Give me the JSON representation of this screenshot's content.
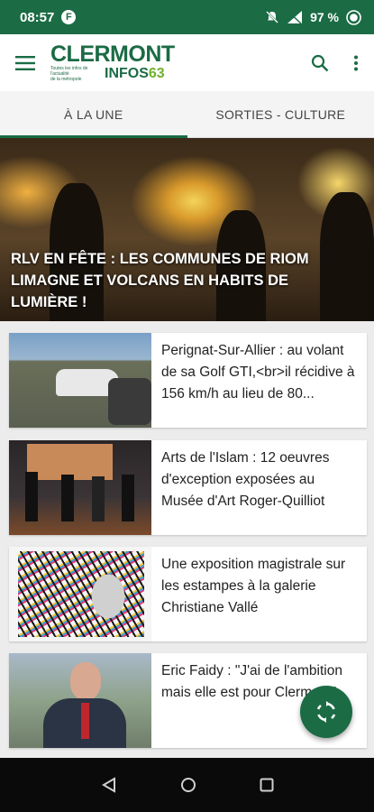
{
  "status_bar": {
    "time": "08:57",
    "notification_badge": "F",
    "battery": "97 %"
  },
  "app_bar": {
    "logo_top": "CLERMONT",
    "logo_tagline_1": "Toutes les infos de l'actualité",
    "logo_tagline_2": "de la métropole",
    "logo_infos": "INFOS",
    "logo_number": "63"
  },
  "tabs": [
    {
      "label": "À LA UNE",
      "active": true
    },
    {
      "label": "SORTIES - CULTURE",
      "active": false
    }
  ],
  "hero": {
    "title": "RLV EN FÊTE : LES COMMUNES DE RIOM LIMAGNE ET VOLCANS EN HABITS DE LUMIÈRE !"
  },
  "articles": [
    {
      "title": "Perignat-Sur-Allier : au volant de sa Golf GTI,<br>il récidive à 156 km/h au lieu de 80..."
    },
    {
      "title": "Arts de l'Islam : 12 oeuvres d'exception exposées au Musée d'Art Roger-Quilliot"
    },
    {
      "title": "Une exposition magistrale sur les estampes à la galerie Christiane Vallé"
    },
    {
      "title": "Eric Faidy : \"J'ai de l'ambition mais elle est pour Clermont\""
    }
  ],
  "colors": {
    "brand": "#1b6b45",
    "brand_light": "#6fb12c"
  },
  "icons": {
    "menu": "menu-icon",
    "search": "search-icon",
    "more": "more-vert-icon",
    "refresh": "refresh-icon"
  }
}
